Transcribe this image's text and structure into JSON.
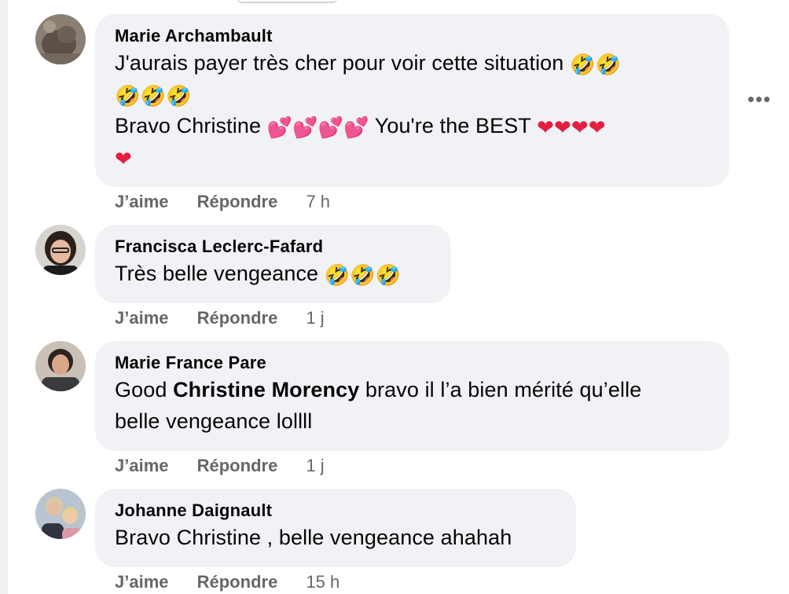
{
  "comments": [
    {
      "author": "Marie Archambault",
      "line1": "J'aurais payer très cher pour voir cette situation ",
      "line1_emoji": "🤣🤣",
      "line2_emoji": "🤣🤣🤣",
      "line3": "Bravo Christine ",
      "line3_emoji": "💕💕💕💕",
      "line3b": " You're the BEST ",
      "line3b_emoji": "❤❤❤❤",
      "line4_emoji": "❤",
      "like": "J’aime",
      "reply": "Répondre",
      "time": "7 h"
    },
    {
      "author": "Francisca Leclerc-Fafard",
      "line1": "Très belle vengeance ",
      "line1_emoji": "🤣🤣🤣",
      "like": "J’aime",
      "reply": "Répondre",
      "time": "1 j"
    },
    {
      "author": "Marie France Pare",
      "line1_pre": "Good ",
      "mention": "Christine Morency",
      "line1_post": " bravo il l’a bien mérité qu’elle",
      "line2": "belle vengeance lollll",
      "like": "J’aime",
      "reply": "Répondre",
      "time": "1 j"
    },
    {
      "author": "Johanne Daignault",
      "line1": "Bravo Christine , belle vengeance ahahah",
      "like": "J’aime",
      "reply": "Répondre",
      "time": "15 h"
    }
  ],
  "more_glyph": "•••",
  "colors": {
    "bubble": "#f0f2f5",
    "secondary_text": "#65676b",
    "primary_text": "#050505",
    "laugh_emoji": "#f5b400",
    "heart_emoji": "#e41e3f"
  }
}
